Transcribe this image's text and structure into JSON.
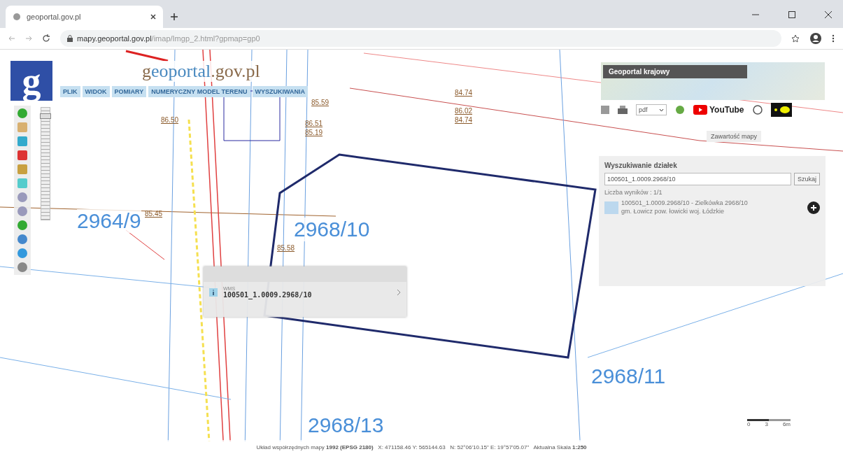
{
  "browser": {
    "tab_title": "geoportal.gov.pl",
    "url_host": "mapy.geoportal.gov.pl",
    "url_path": "/imap/Imgp_2.html?gpmap=gp0"
  },
  "brand": {
    "logo_letter": "g",
    "title_first": "g",
    "title_accent": "eoportal",
    "title_rest": ".gov.pl"
  },
  "menu": [
    {
      "label": "PLIK"
    },
    {
      "label": "WIDOK"
    },
    {
      "label": "POMIARY"
    },
    {
      "label": "NUMERYCZNY MODEL TERENU"
    },
    {
      "label": "WYSZUKIWANIA"
    }
  ],
  "minimap": {
    "title": "Geoportal krajowy"
  },
  "toolbar": {
    "format": "pdf",
    "video_label": "YouTube",
    "contents_label": "Zawartość mapy"
  },
  "search_panel": {
    "title": "Wyszukiwanie działek",
    "value": "100501_1.0009.2968/10",
    "button": "Szukaj",
    "count": "Liczba wyników : 1/1",
    "result_line_1": "100501_1.0009.2968/10 - Zielkówka 2968/10",
    "result_line_2": "gm. Łowicz pow. łowicki woj. Łódzkie"
  },
  "popup": {
    "layer": "WMS",
    "parcel_id": "100501_1.0009.2968/10"
  },
  "zoom": {
    "level": 0.95
  },
  "parcel_labels": [
    {
      "text": "2964/9"
    },
    {
      "text": "2968/10"
    },
    {
      "text": "2968/11"
    },
    {
      "text": "2968/13"
    }
  ],
  "elevation_labels": [
    {
      "text": "84.74"
    },
    {
      "text": "85.59"
    },
    {
      "text": "86.02"
    },
    {
      "text": "84.74"
    },
    {
      "text": "86.50"
    },
    {
      "text": "86.51"
    },
    {
      "text": "85.19"
    },
    {
      "text": "85.45"
    },
    {
      "text": "85.58"
    }
  ],
  "scale_bar": {
    "labels": [
      "0",
      "3",
      "6m"
    ]
  },
  "status_bar": "Układ współrzędnych mapy **1992 (EPSG 2180)**   X: 471158.46 Y: 565144.63   N: 52°06'10.15\" E: 19°57'05.07\"   Aktualna Skala **1:250**"
}
